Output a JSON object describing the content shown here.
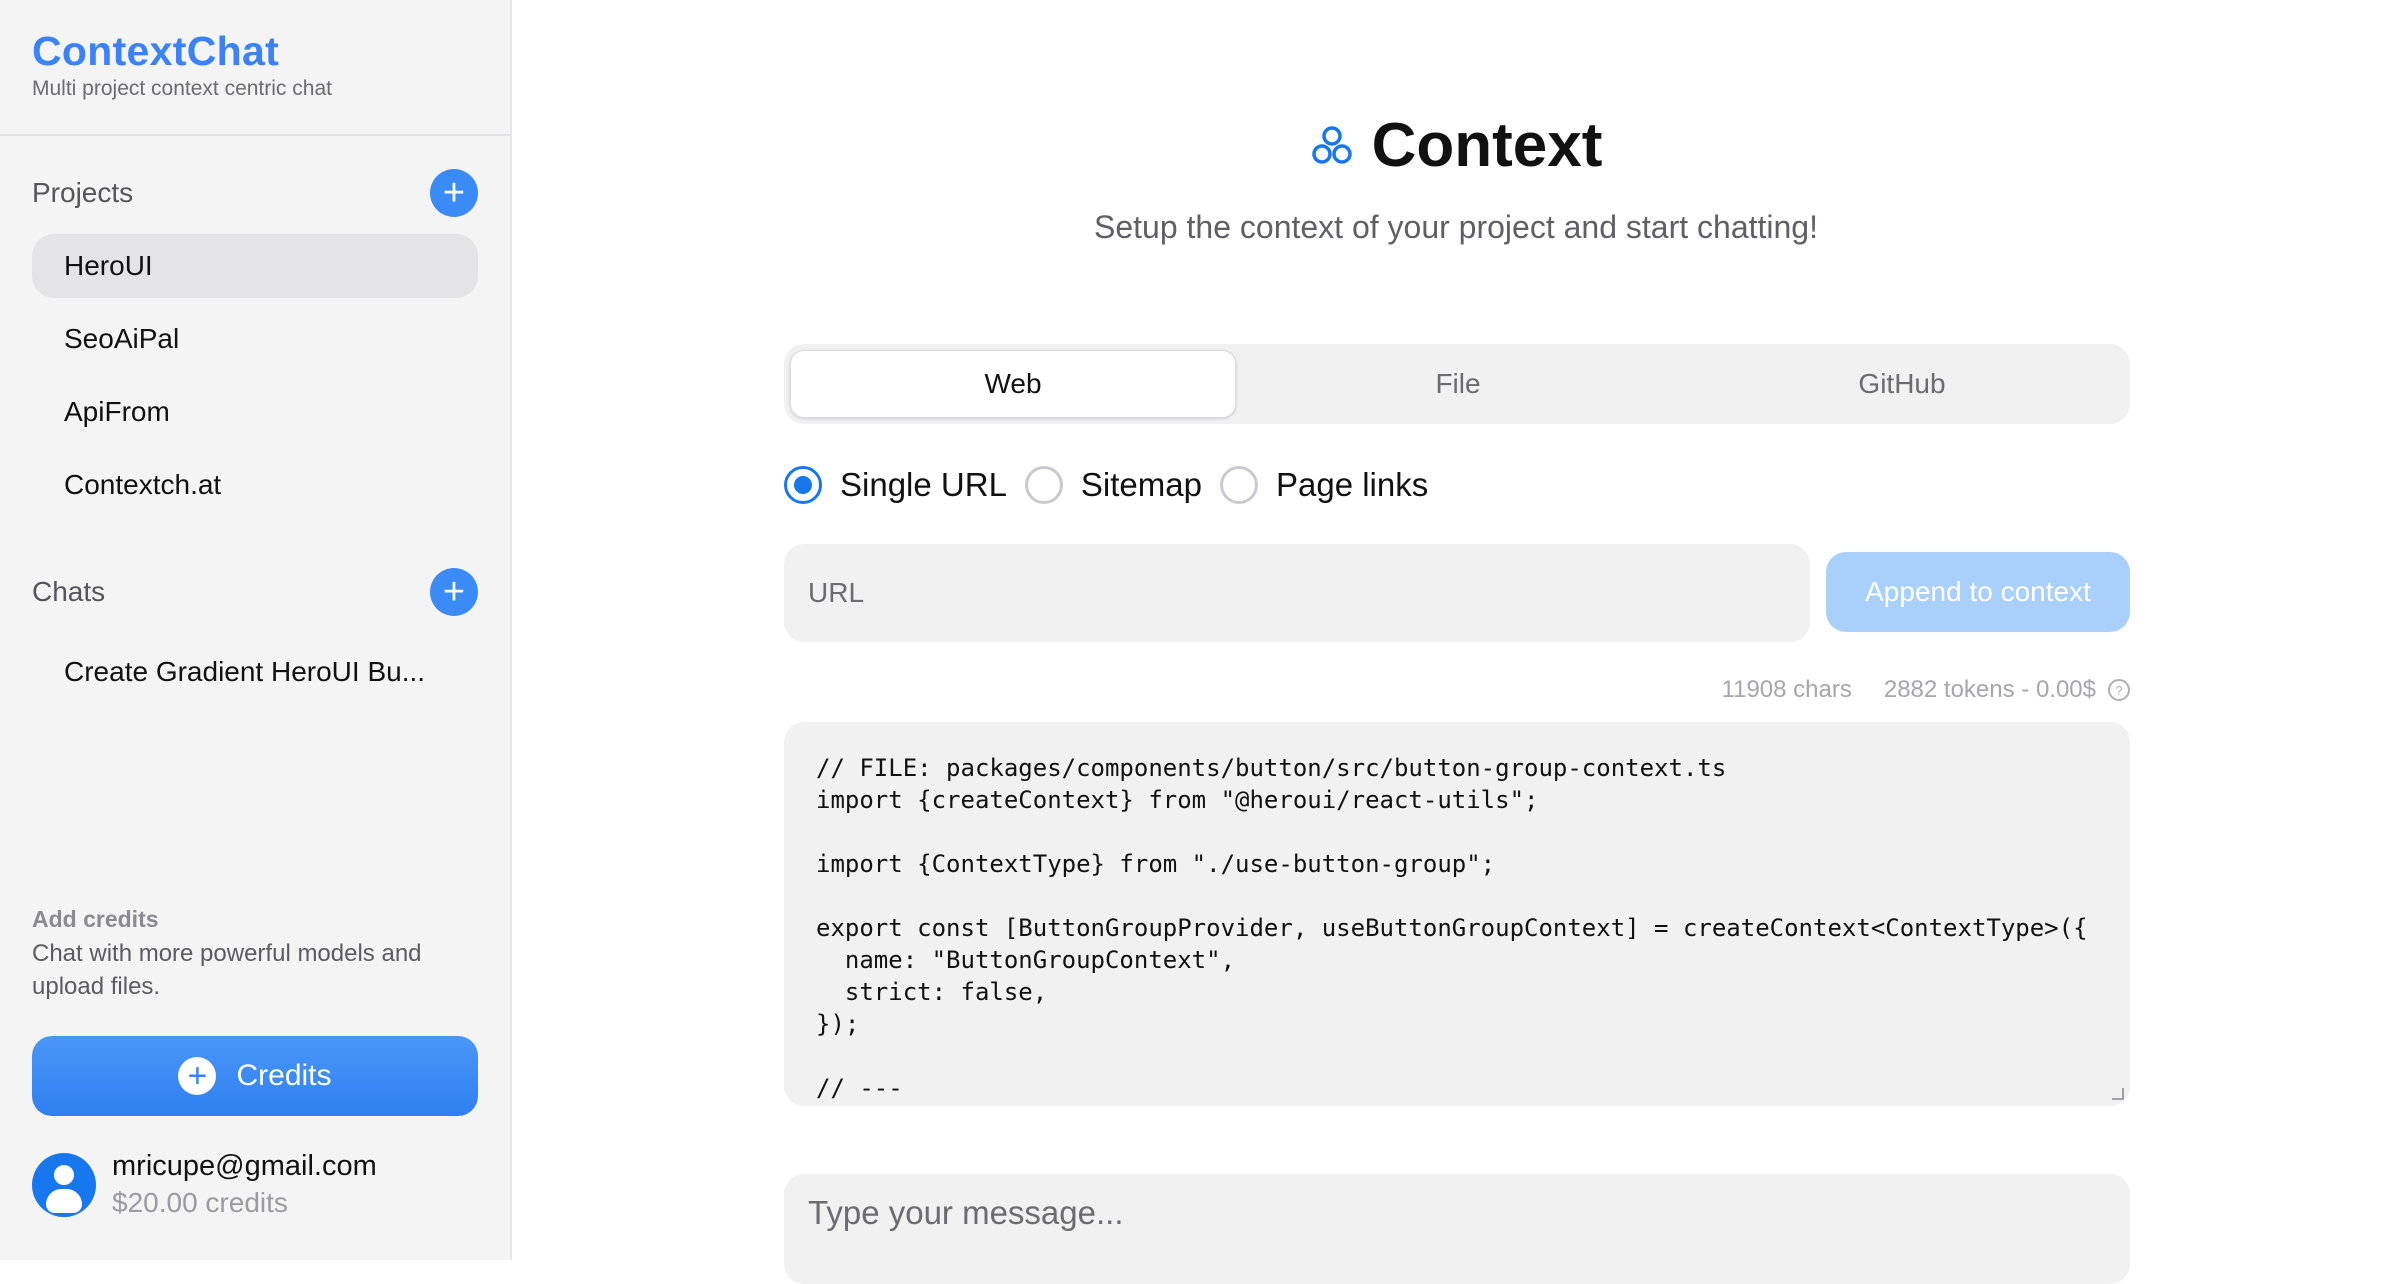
{
  "brand": {
    "title": "ContextChat",
    "subtitle": "Multi project context centric chat"
  },
  "sidebar": {
    "projects_label": "Projects",
    "projects": [
      {
        "label": "HeroUI",
        "active": true
      },
      {
        "label": "SeoAiPal",
        "active": false
      },
      {
        "label": "ApiFrom",
        "active": false
      },
      {
        "label": "Contextch.at",
        "active": false
      }
    ],
    "chats_label": "Chats",
    "chats": [
      {
        "label": "Create Gradient HeroUI Bu..."
      }
    ],
    "add_credits_title": "Add credits",
    "add_credits_text": "Chat with more powerful models and upload files.",
    "credits_button": "Credits",
    "user": {
      "email": "mricupe@gmail.com",
      "credits": "$20.00 credits"
    }
  },
  "main": {
    "title": "Context",
    "subtitle": "Setup the context of your project and start chatting!",
    "tabs": [
      {
        "label": "Web",
        "active": true
      },
      {
        "label": "File",
        "active": false
      },
      {
        "label": "GitHub",
        "active": false
      }
    ],
    "radio_options": [
      {
        "label": "Single URL",
        "checked": true
      },
      {
        "label": "Sitemap",
        "checked": false
      },
      {
        "label": "Page links",
        "checked": false
      }
    ],
    "url_placeholder": "URL",
    "append_button": "Append to context",
    "stats": {
      "chars": "11908 chars",
      "tokens": "2882 tokens - 0.00$"
    },
    "code_lines": [
      "// FILE: packages/components/button/src/button-group-context.ts",
      "import {createContext} from \"@heroui/react-utils\";",
      "",
      "import {ContextType} from \"./use-button-group\";",
      "",
      "export const [ButtonGroupProvider, useButtonGroupContext] = createContext<ContextType>({",
      "  name: \"ButtonGroupContext\",",
      "  strict: false,",
      "});",
      "",
      "// ---"
    ],
    "message_placeholder": "Type your message..."
  },
  "colors": {
    "accent": "#3b82f6",
    "append_disabled": "#a9d0fb"
  },
  "icons": {
    "context_icon": "trefoil-icon",
    "add_icon": "plus-icon",
    "info_icon": "info-icon",
    "user_icon": "user-avatar-icon"
  }
}
